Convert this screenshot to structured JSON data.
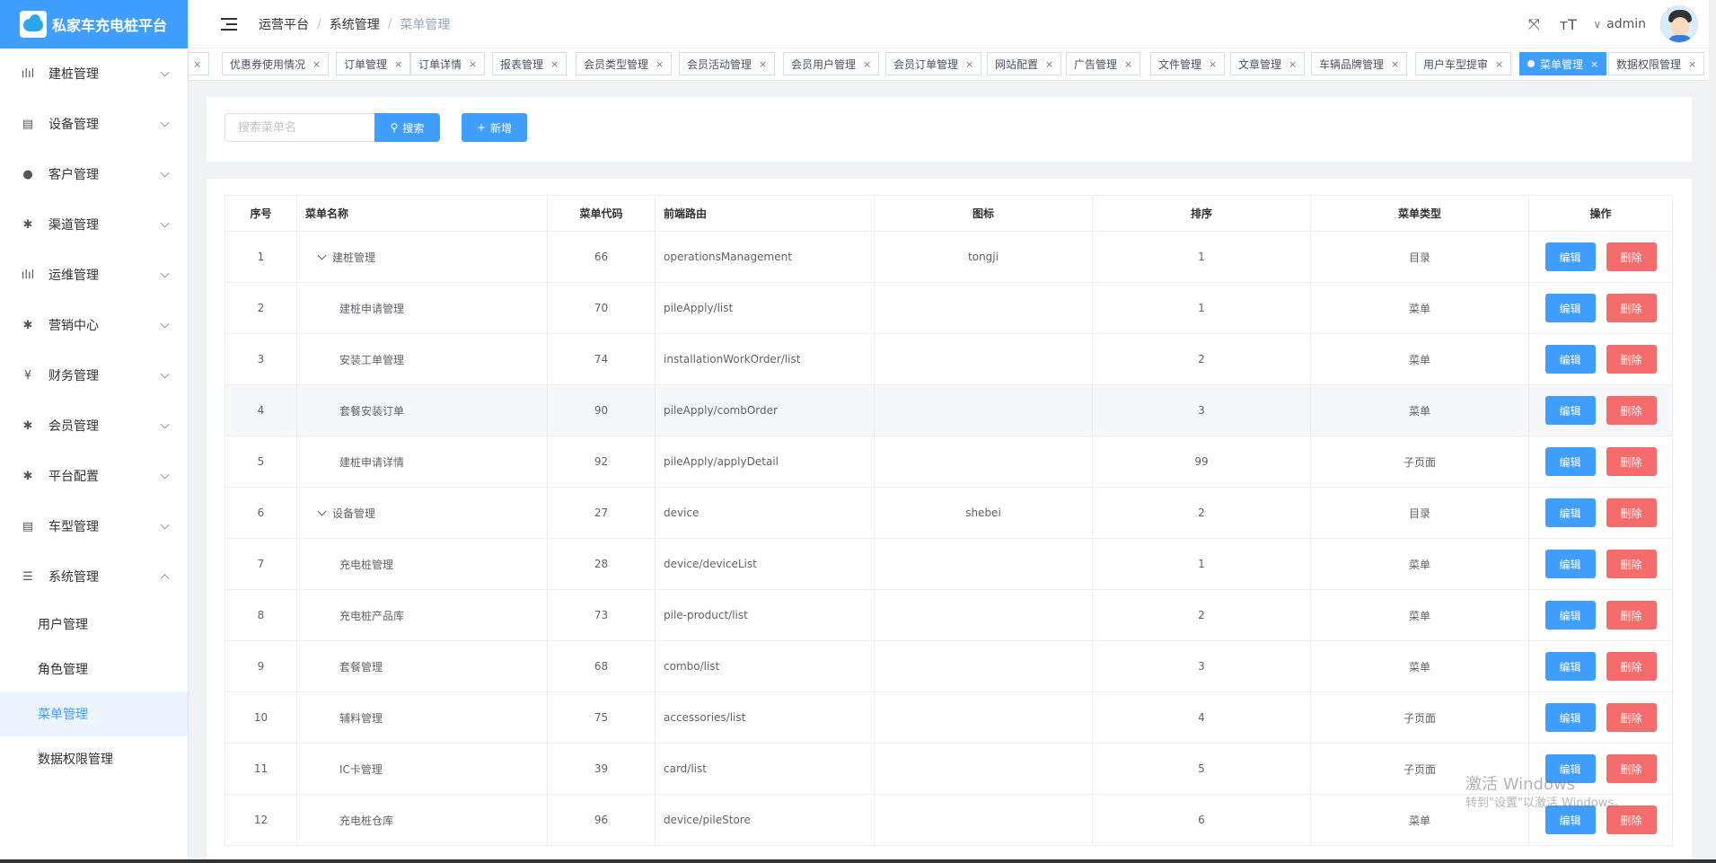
{
  "app": {
    "title": "私家车充电桩平台"
  },
  "sidebar": {
    "items": [
      {
        "label": "建桩管理",
        "icon": "chart-icon",
        "glyph": "ılıl"
      },
      {
        "label": "设备管理",
        "icon": "device-icon",
        "glyph": "▤"
      },
      {
        "label": "客户管理",
        "icon": "user-icon",
        "glyph": "●"
      },
      {
        "label": "渠道管理",
        "icon": "gear-icon",
        "glyph": "✱"
      },
      {
        "label": "运维管理",
        "icon": "chart-icon",
        "glyph": "ılıl"
      },
      {
        "label": "营销中心",
        "icon": "gear-icon",
        "glyph": "✱"
      },
      {
        "label": "财务管理",
        "icon": "yen-icon",
        "glyph": "¥"
      },
      {
        "label": "会员管理",
        "icon": "gear-icon",
        "glyph": "✱"
      },
      {
        "label": "平台配置",
        "icon": "gear-icon",
        "glyph": "✱"
      },
      {
        "label": "车型管理",
        "icon": "device-icon",
        "glyph": "▤"
      },
      {
        "label": "系统管理",
        "icon": "list-icon",
        "glyph": "☰"
      }
    ],
    "submenu": [
      {
        "label": "用户管理"
      },
      {
        "label": "角色管理"
      },
      {
        "label": "菜单管理"
      },
      {
        "label": "数据权限管理"
      }
    ]
  },
  "header": {
    "breadcrumb": [
      "运营平台",
      "系统管理",
      "菜单管理"
    ],
    "separator": "/",
    "user": "admin",
    "caret": "∨",
    "fullscreen_glyph": "⤧",
    "size_glyph": "ᴛT"
  },
  "tags": [
    {
      "label": "ᵎ"
    },
    {
      "label": "优惠券使用情况"
    },
    {
      "label": "订单管理"
    },
    {
      "label": "订单详情"
    },
    {
      "label": "报表管理"
    },
    {
      "label": "会员类型管理"
    },
    {
      "label": "会员活动管理"
    },
    {
      "label": "会员用户管理"
    },
    {
      "label": "会员订单管理"
    },
    {
      "label": "网站配置"
    },
    {
      "label": "广告管理"
    },
    {
      "label": "文件管理"
    },
    {
      "label": "文章管理"
    },
    {
      "label": "车辆品牌管理"
    },
    {
      "label": "用户车型提审"
    },
    {
      "label": "菜单管理",
      "active": true
    },
    {
      "label": "数据权限管理"
    }
  ],
  "tag_close": "×",
  "search": {
    "placeholder": "搜索菜单名",
    "value": "",
    "button_label": "搜索",
    "add_label": "新增",
    "search_glyph": "⚲",
    "add_glyph": "+"
  },
  "table": {
    "headers": [
      "序号",
      "菜单名称",
      "菜单代码",
      "前端路由",
      "图标",
      "排序",
      "菜单类型",
      "操作"
    ],
    "edit_label": "编辑",
    "delete_label": "删除",
    "rows": [
      {
        "no": "1",
        "name": "建桩管理",
        "code": "66",
        "route": "operationsManagement",
        "icon": "tongji",
        "sort": "1",
        "type": "目录",
        "parent": true
      },
      {
        "no": "2",
        "name": "建桩申请管理",
        "code": "70",
        "route": "pileApply/list",
        "icon": "",
        "sort": "1",
        "type": "菜单",
        "parent": false
      },
      {
        "no": "3",
        "name": "安装工单管理",
        "code": "74",
        "route": "installationWorkOrder/list",
        "icon": "",
        "sort": "2",
        "type": "菜单",
        "parent": false
      },
      {
        "no": "4",
        "name": "套餐安装订单",
        "code": "90",
        "route": "pileApply/combOrder",
        "icon": "",
        "sort": "3",
        "type": "菜单",
        "parent": false
      },
      {
        "no": "5",
        "name": "建桩申请详情",
        "code": "92",
        "route": "pileApply/applyDetail",
        "icon": "",
        "sort": "99",
        "type": "子页面",
        "parent": false
      },
      {
        "no": "6",
        "name": "设备管理",
        "code": "27",
        "route": "device",
        "icon": "shebei",
        "sort": "2",
        "type": "目录",
        "parent": true
      },
      {
        "no": "7",
        "name": "充电桩管理",
        "code": "28",
        "route": "device/deviceList",
        "icon": "",
        "sort": "1",
        "type": "菜单",
        "parent": false
      },
      {
        "no": "8",
        "name": "充电桩产品库",
        "code": "73",
        "route": "pile-product/list",
        "icon": "",
        "sort": "2",
        "type": "菜单",
        "parent": false
      },
      {
        "no": "9",
        "name": "套餐管理",
        "code": "68",
        "route": "combo/list",
        "icon": "",
        "sort": "3",
        "type": "菜单",
        "parent": false
      },
      {
        "no": "10",
        "name": "辅料管理",
        "code": "75",
        "route": "accessories/list",
        "icon": "",
        "sort": "4",
        "type": "子页面",
        "parent": false
      },
      {
        "no": "11",
        "name": "IC卡管理",
        "code": "39",
        "route": "card/list",
        "icon": "",
        "sort": "5",
        "type": "子页面",
        "parent": false
      },
      {
        "no": "12",
        "name": "充电桩仓库",
        "code": "96",
        "route": "device/pileStore",
        "icon": "",
        "sort": "6",
        "type": "菜单",
        "parent": false
      }
    ]
  },
  "watermark": {
    "line1": "激活 Windows",
    "line2": "转到\"设置\"以激活 Windows。"
  },
  "colors": {
    "primary": "#409eff",
    "danger": "#f56c6c",
    "active_menu_bg": "#ecf5ff"
  }
}
